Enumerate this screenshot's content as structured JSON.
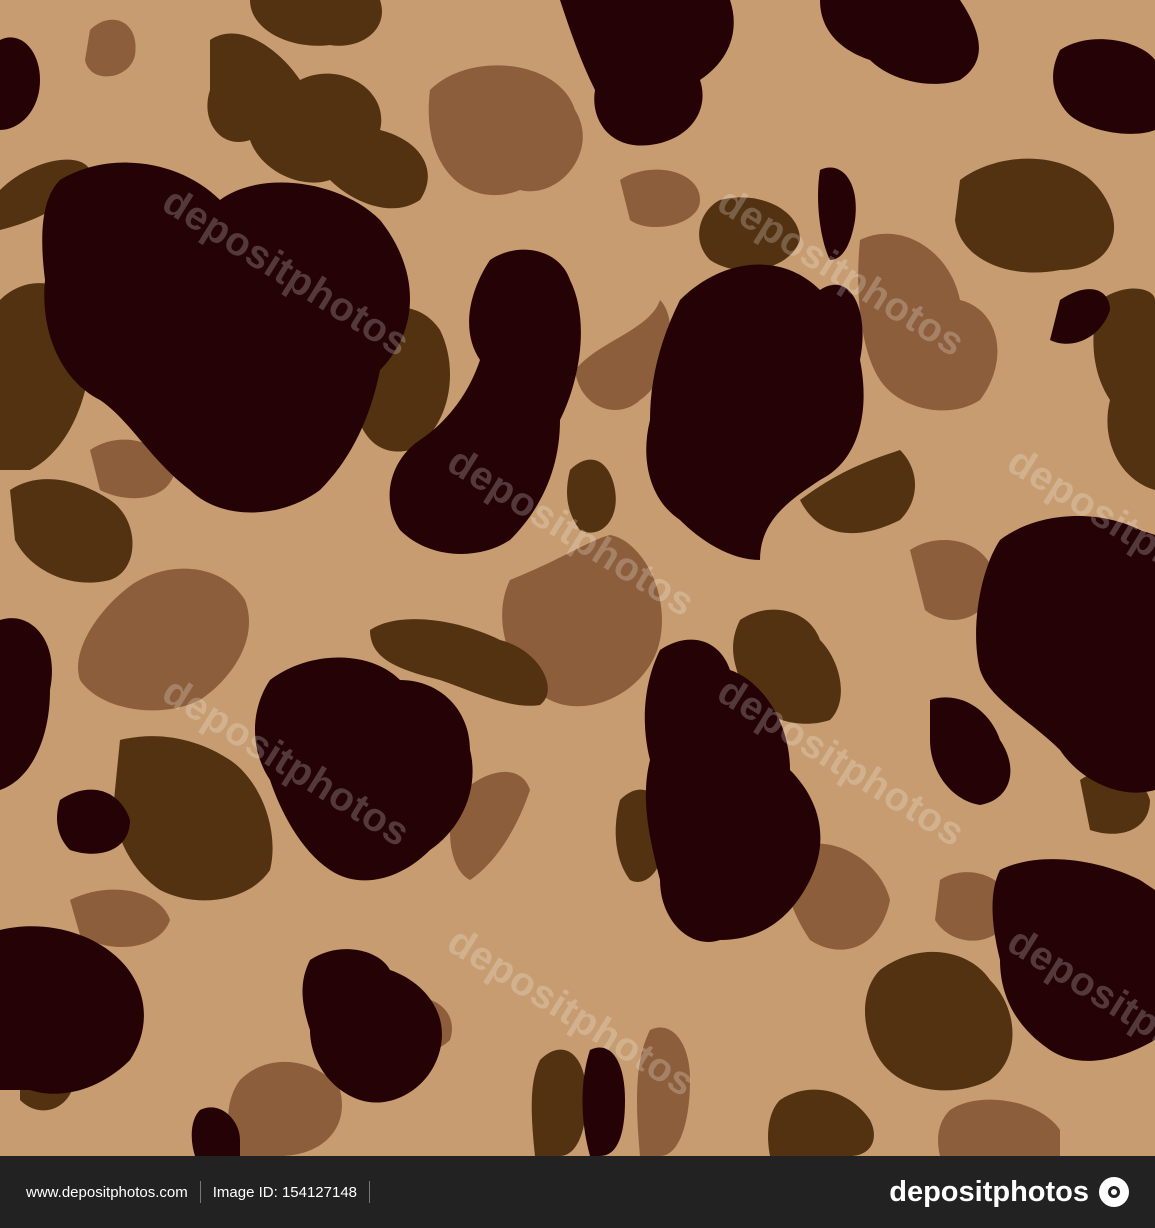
{
  "colors": {
    "background": "#c69c70",
    "light_spot": "#8c5e3b",
    "medium_spot": "#533211",
    "dark_spot": "#250206",
    "footer_background": "#222222"
  },
  "watermark": {
    "text": "depositphotos"
  },
  "footer": {
    "website": "www.depositphotos.com",
    "image_id": "Image ID: 154127148",
    "brand": "depositphotos",
    "logo_icon": "camera-lens-icon"
  }
}
